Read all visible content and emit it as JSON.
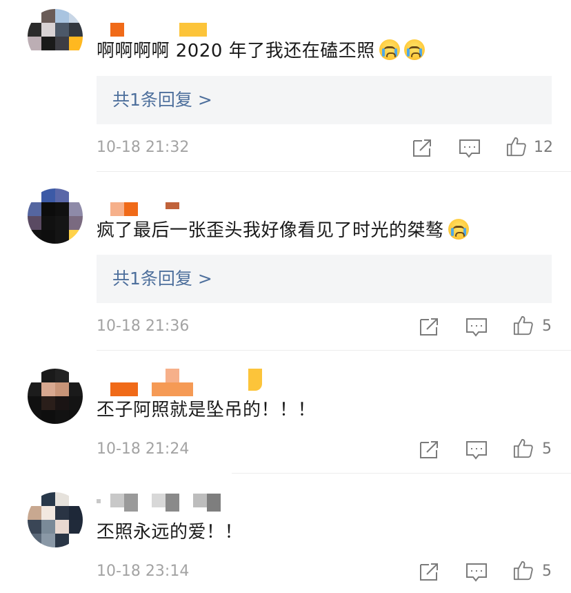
{
  "comments": [
    {
      "text": "啊啊啊啊 2020 年了我还在磕丕照",
      "reply_label": "共1条回复 >",
      "time": "10-18 21:32",
      "likes": "12",
      "emoji_icons": [
        "crying-face-icon",
        "crying-face-icon"
      ]
    },
    {
      "text": "疯了最后一张歪头我好像看见了时光的桀骜",
      "reply_label": "共1条回复 >",
      "time": "10-18 21:36",
      "likes": "5",
      "emoji_icons": [
        "crying-face-icon"
      ]
    },
    {
      "text": "丕子阿照就是坠吊的！！！",
      "time": "10-18 21:24",
      "likes": "5"
    },
    {
      "text": "丕照永远的爱！！",
      "time": "10-18 23:14",
      "likes": "5"
    }
  ],
  "icons": {
    "share": "share-icon",
    "comment": "comment-icon",
    "like": "thumbs-up-icon"
  },
  "colors": {
    "reply_link": "#4d6f9c",
    "meta": "#a3a3a3",
    "reply_bg": "#f4f5f6"
  }
}
